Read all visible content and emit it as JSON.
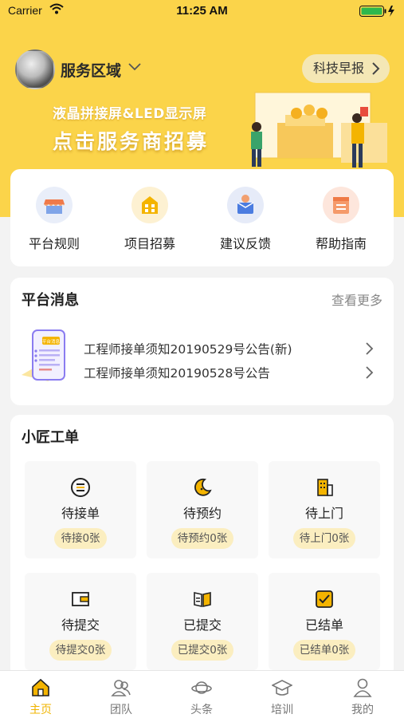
{
  "status_bar": {
    "carrier": "Carrier",
    "time": "11:25 AM"
  },
  "header": {
    "region_label": "服务区域",
    "news_button": "科技早报"
  },
  "banner": {
    "line1": "液晶拼接屏&LED显示屏",
    "line2": "点击服务商招募"
  },
  "quick_links": [
    {
      "label": "平台规则",
      "icon": "storefront-icon"
    },
    {
      "label": "项目招募",
      "icon": "building-icon"
    },
    {
      "label": "建议反馈",
      "icon": "feedback-icon"
    },
    {
      "label": "帮助指南",
      "icon": "guide-icon"
    }
  ],
  "messages": {
    "title": "平台消息",
    "more": "查看更多",
    "illustration_text": "平台消息",
    "items": [
      "工程师接单须知20190529号公告(新)",
      "工程师接单须知20190528号公告"
    ]
  },
  "orders": {
    "title": "小匠工单",
    "tiles": [
      {
        "label": "待接单",
        "badge": "待接0张",
        "icon": "list-icon"
      },
      {
        "label": "待预约",
        "badge": "待预约0张",
        "icon": "moon-icon"
      },
      {
        "label": "待上门",
        "badge": "待上门0张",
        "icon": "building-icon"
      },
      {
        "label": "待提交",
        "badge": "待提交0张",
        "icon": "wallet-icon"
      },
      {
        "label": "已提交",
        "badge": "已提交0张",
        "icon": "book-icon"
      },
      {
        "label": "已结单",
        "badge": "已结单0张",
        "icon": "checkbox-icon"
      }
    ]
  },
  "tabbar": {
    "items": [
      {
        "label": "主页",
        "icon": "home-icon",
        "active": true
      },
      {
        "label": "团队",
        "icon": "team-icon",
        "active": false
      },
      {
        "label": "头条",
        "icon": "planet-icon",
        "active": false
      },
      {
        "label": "培训",
        "icon": "graduation-cap-icon",
        "active": false
      },
      {
        "label": "我的",
        "icon": "user-icon",
        "active": false
      }
    ]
  },
  "colors": {
    "accent": "#fbd44a",
    "active_tab": "#f0b400",
    "badge_bg": "#fbeec0"
  }
}
